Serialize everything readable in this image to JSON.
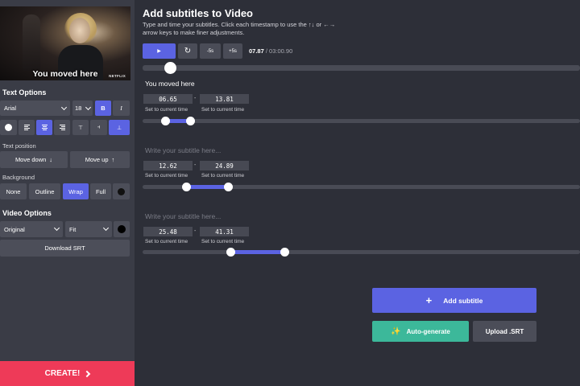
{
  "video": {
    "caption": "You moved here",
    "logo": "NETFLIX"
  },
  "text_options": {
    "heading": "Text Options",
    "font": "Arial",
    "size": "18",
    "bold_label": "B",
    "italic_label": "I",
    "text_color": "#ffffff"
  },
  "text_position": {
    "heading": "Text position",
    "move_down": "Move down",
    "move_up": "Move up"
  },
  "background": {
    "heading": "Background",
    "options": [
      "None",
      "Outline",
      "Wrap",
      "Full"
    ],
    "selected": "Wrap",
    "color": "#111111"
  },
  "video_options": {
    "heading": "Video Options",
    "aspect": "Original",
    "fit": "Fit",
    "color": "#000000",
    "download": "Download SRT"
  },
  "create_label": "CREATE!",
  "main": {
    "title": "Add subtitles to Video",
    "instructions": "Type and time your subtitles. Click each timestamp to use the ↑↓ or ←→ arrow keys to make finer adjustments."
  },
  "player": {
    "back_5": "-5s",
    "fwd_5": "+5s",
    "current": "07.87",
    "total": "/ 03:00.90",
    "position_fraction": 0.044
  },
  "subtitles": [
    {
      "text": "You moved here",
      "start": "06.65",
      "end": "13.81",
      "set_start": "Set to current time",
      "set_end": "Set to current time"
    },
    {
      "text": "",
      "start": "12.62",
      "end": "24.89",
      "set_start": "Set to current time",
      "set_end": "Set to current time"
    },
    {
      "text": "",
      "start": "25.48",
      "end": "41.31",
      "set_start": "Set to current time",
      "set_end": "Set to current time"
    }
  ],
  "subtitle_placeholder": "Write your subtitle here...",
  "actions": {
    "add_subtitle": "Add subtitle",
    "auto_generate": "Auto-generate",
    "upload_srt": "Upload .SRT"
  },
  "colors": {
    "accent": "#5b63e2",
    "create": "#ee3a58",
    "auto": "#3cb89a"
  }
}
